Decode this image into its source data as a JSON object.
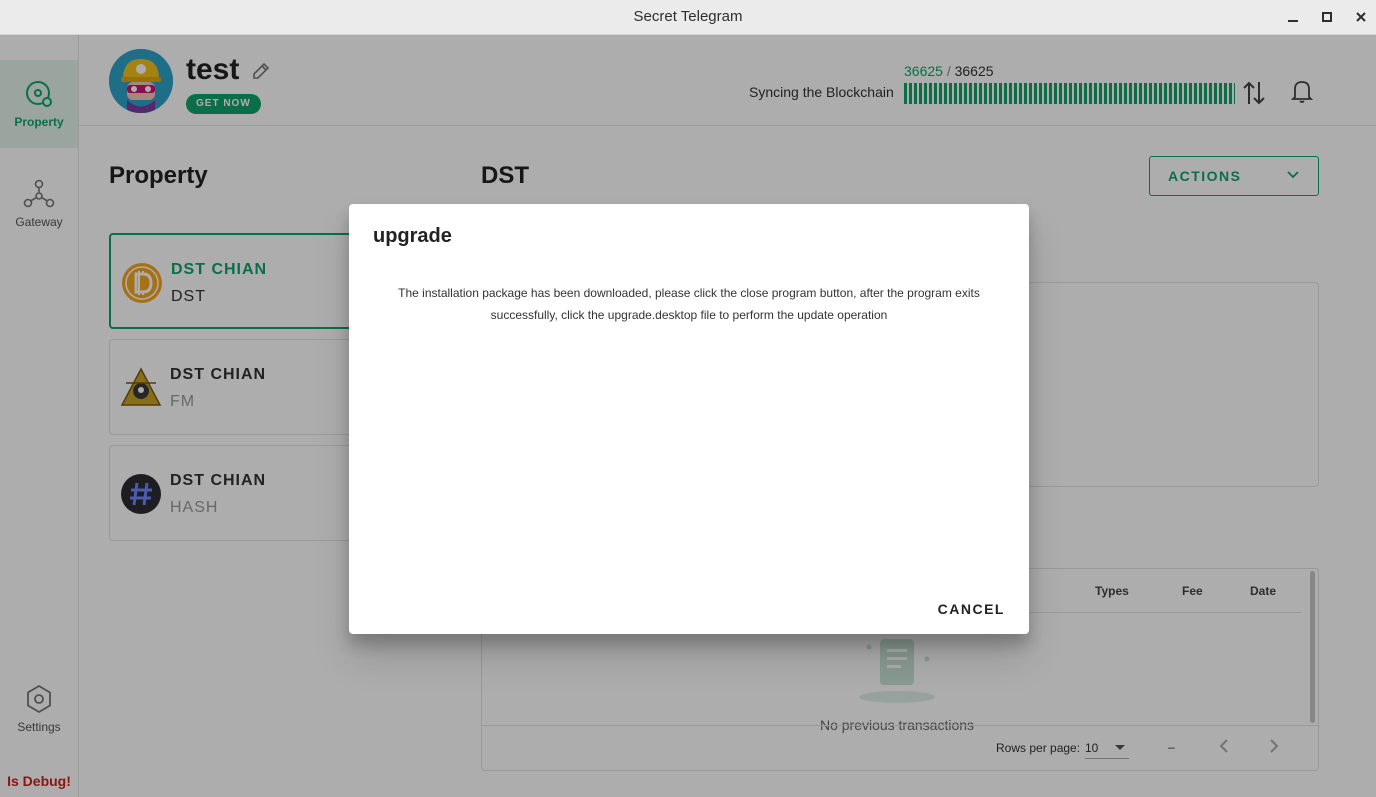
{
  "window": {
    "title": "Secret Telegram"
  },
  "sidebar": {
    "items": [
      {
        "label": "Property",
        "icon": "property-icon",
        "active": true
      },
      {
        "label": "Gateway",
        "icon": "gateway-icon",
        "active": false
      },
      {
        "label": "Settings",
        "icon": "settings-icon",
        "active": false
      }
    ],
    "debug_label": "Is Debug!"
  },
  "header": {
    "username": "test",
    "get_now_label": "GET NOW",
    "sync_label": "Syncing the Blockchain",
    "sync_current": "36625",
    "sync_separator": "/",
    "sync_total": "36625",
    "sync_progress": 1.0
  },
  "main": {
    "property_title": "Property",
    "tokens": [
      {
        "name": "DST CHIAN",
        "symbol": "DST",
        "active": true,
        "icon": "dst-coin-icon"
      },
      {
        "name": "DST CHIAN",
        "symbol": "FM",
        "active": false,
        "icon": "fm-emblem-icon"
      },
      {
        "name": "DST CHIAN",
        "symbol": "HASH",
        "active": false,
        "icon": "hash-icon"
      }
    ],
    "detail_title": "DST",
    "actions_label": "ACTIONS",
    "table": {
      "columns": [
        "nt",
        "Types",
        "Fee",
        "Date"
      ],
      "empty_text": "No previous transactions",
      "rows_per_page_label": "Rows per page:",
      "rows_per_page_value": "10",
      "range_text": "–"
    }
  },
  "dialog": {
    "title": "upgrade",
    "message": "The installation package has been downloaded, please click the close program button, after the program exits successfully, click the upgrade.desktop file to perform the update operation",
    "cancel_label": "CANCEL"
  },
  "colors": {
    "accent": "#10a46a",
    "debug": "#d21e1e"
  }
}
